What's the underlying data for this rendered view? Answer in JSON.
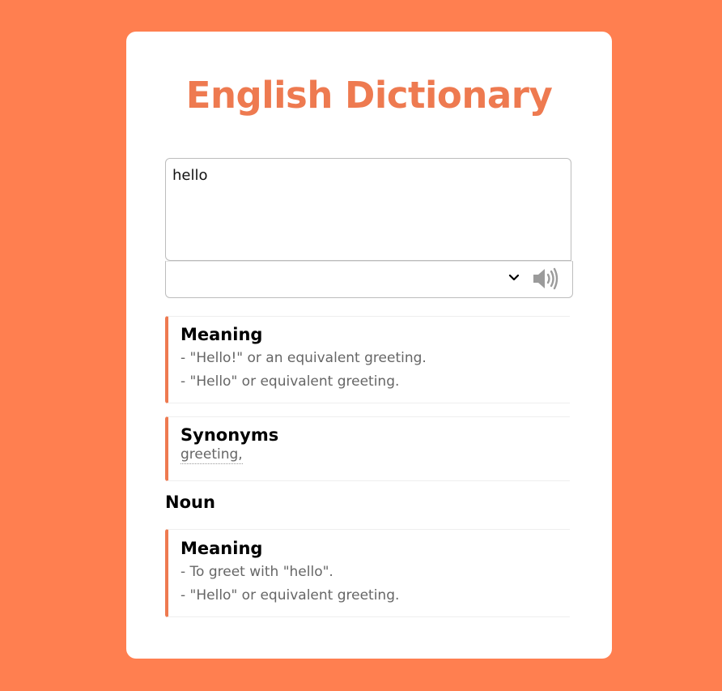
{
  "app": {
    "title": "English Dictionary"
  },
  "search": {
    "value": "hello"
  },
  "sections": {
    "meaning1": {
      "heading": "Meaning",
      "items": [
        "- \"Hello!\" or an equivalent greeting.",
        "- \"Hello\" or equivalent greeting."
      ]
    },
    "synonyms": {
      "heading": "Synonyms",
      "items": [
        "greeting,"
      ]
    },
    "part_of_speech": "Noun",
    "meaning2": {
      "heading": "Meaning",
      "items": [
        "- To greet with \"hello\".",
        "- \"Hello\" or equivalent greeting."
      ]
    }
  },
  "icons": {
    "expand": "chevron-down-icon",
    "audio": "speaker-icon"
  },
  "colors": {
    "background": "#FF7F50",
    "accent": "#EE7A50",
    "card": "#FFFFFF",
    "muted_text": "#666666"
  }
}
